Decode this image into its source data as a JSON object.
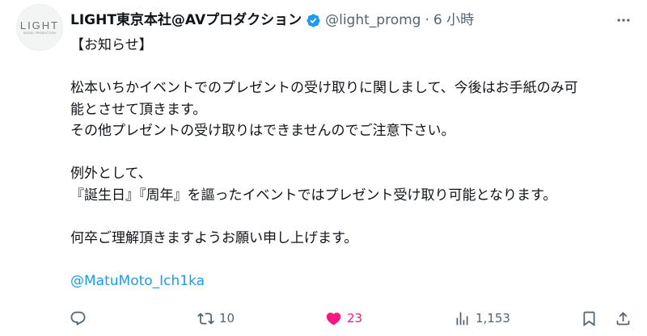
{
  "author": {
    "display_name": "LIGHT東京本社@AVプロダクション",
    "handle": "@light_promg",
    "separator": "·",
    "time": "6 小時",
    "avatar_logo": "LIGHT",
    "avatar_sub": "MODEL PRODUCTION"
  },
  "icons": {
    "verified": "verified-badge-icon",
    "more": "more-options-icon",
    "reply": "reply-icon",
    "retweet": "retweet-icon",
    "like": "like-heart-icon",
    "views": "views-chart-icon",
    "bookmark": "bookmark-icon",
    "share": "share-icon"
  },
  "colors": {
    "text": "#0f1419",
    "secondary": "#536471",
    "link": "#1d9bf0",
    "like": "#f91880",
    "verified": "#1d9bf0"
  },
  "tweet": {
    "lines": [
      "【お知らせ】",
      "",
      "松本いちかイベントでのプレゼントの受け取りに関しまして、今後はお手紙のみ可",
      "能とさせて頂きます。",
      "その他プレゼントの受け取りはできませんのでご注意下さい。",
      "",
      "例外として、",
      "『誕生日』『周年』を謳ったイベントではプレゼント受け取り可能となります。",
      "",
      "何卒ご理解頂きますようお願い申し上げます。",
      ""
    ],
    "mention": "@MatuMoto_Ich1ka"
  },
  "actions": {
    "reply_count": "",
    "retweet_count": "10",
    "like_count": "23",
    "views_count": "1,153"
  }
}
